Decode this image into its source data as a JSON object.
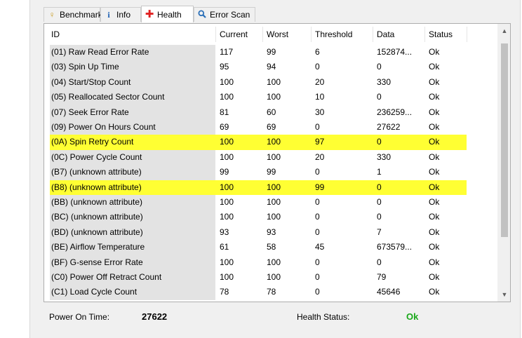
{
  "tabs": [
    {
      "label": "Benchmark",
      "icon": "benchmark-icon",
      "glyph": "♀",
      "color": "#c79a1e"
    },
    {
      "label": "Info",
      "icon": "info-icon",
      "glyph": "i",
      "color": "#1c5fb3"
    },
    {
      "label": "Health",
      "icon": "health-cross-icon",
      "glyph": "✚",
      "color": "#e02020",
      "active": true
    },
    {
      "label": "Error Scan",
      "icon": "magnifier-icon",
      "glyph": "⌕",
      "color": "#2a6fb8"
    }
  ],
  "table": {
    "columns": [
      "ID",
      "Current",
      "Worst",
      "Threshold",
      "Data",
      "Status"
    ],
    "rows": [
      {
        "id": "(01) Raw Read Error Rate",
        "current": "117",
        "worst": "99",
        "threshold": "6",
        "data": "152874...",
        "status": "Ok"
      },
      {
        "id": "(03) Spin Up Time",
        "current": "95",
        "worst": "94",
        "threshold": "0",
        "data": "0",
        "status": "Ok"
      },
      {
        "id": "(04) Start/Stop Count",
        "current": "100",
        "worst": "100",
        "threshold": "20",
        "data": "330",
        "status": "Ok"
      },
      {
        "id": "(05) Reallocated Sector Count",
        "current": "100",
        "worst": "100",
        "threshold": "10",
        "data": "0",
        "status": "Ok"
      },
      {
        "id": "(07) Seek Error Rate",
        "current": "81",
        "worst": "60",
        "threshold": "30",
        "data": "236259...",
        "status": "Ok"
      },
      {
        "id": "(09) Power On Hours Count",
        "current": "69",
        "worst": "69",
        "threshold": "0",
        "data": "27622",
        "status": "Ok"
      },
      {
        "id": "(0A) Spin Retry Count",
        "current": "100",
        "worst": "100",
        "threshold": "97",
        "data": "0",
        "status": "Ok",
        "highlight": true
      },
      {
        "id": "(0C) Power Cycle Count",
        "current": "100",
        "worst": "100",
        "threshold": "20",
        "data": "330",
        "status": "Ok"
      },
      {
        "id": "(B7) (unknown attribute)",
        "current": "99",
        "worst": "99",
        "threshold": "0",
        "data": "1",
        "status": "Ok"
      },
      {
        "id": "(B8) (unknown attribute)",
        "current": "100",
        "worst": "100",
        "threshold": "99",
        "data": "0",
        "status": "Ok",
        "highlight": true
      },
      {
        "id": "(BB) (unknown attribute)",
        "current": "100",
        "worst": "100",
        "threshold": "0",
        "data": "0",
        "status": "Ok"
      },
      {
        "id": "(BC) (unknown attribute)",
        "current": "100",
        "worst": "100",
        "threshold": "0",
        "data": "0",
        "status": "Ok"
      },
      {
        "id": "(BD) (unknown attribute)",
        "current": "93",
        "worst": "93",
        "threshold": "0",
        "data": "7",
        "status": "Ok"
      },
      {
        "id": "(BE) Airflow Temperature",
        "current": "61",
        "worst": "58",
        "threshold": "45",
        "data": "673579...",
        "status": "Ok"
      },
      {
        "id": "(BF) G-sense Error Rate",
        "current": "100",
        "worst": "100",
        "threshold": "0",
        "data": "0",
        "status": "Ok"
      },
      {
        "id": "(C0) Power Off Retract Count",
        "current": "100",
        "worst": "100",
        "threshold": "0",
        "data": "79",
        "status": "Ok"
      },
      {
        "id": "(C1) Load Cycle Count",
        "current": "78",
        "worst": "78",
        "threshold": "0",
        "data": "45646",
        "status": "Ok"
      }
    ]
  },
  "footer": {
    "power_on_label": "Power On Time:",
    "power_on_value": "27622",
    "health_label": "Health Status:",
    "health_value": "Ok"
  },
  "colors": {
    "highlight": "#ffff33",
    "id_column_bg": "#e3e3e3",
    "health_ok": "#1aa81a"
  }
}
